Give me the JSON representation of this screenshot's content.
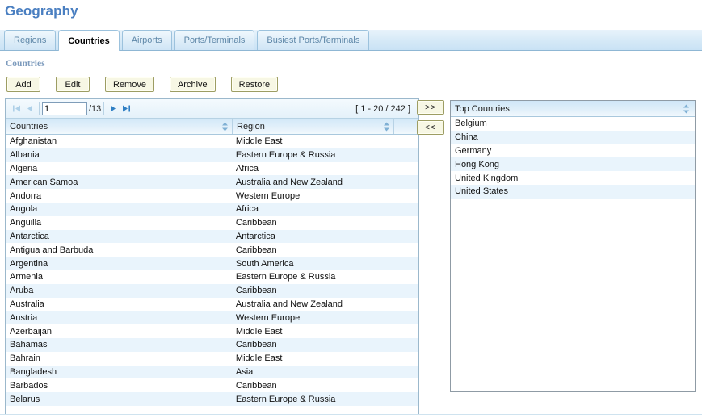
{
  "page": {
    "title": "Geography",
    "section_caption": "Countries",
    "title_color": "#4a7fc1",
    "caption_color": "#7d9bbd"
  },
  "tabs": [
    {
      "label": "Regions",
      "active": false
    },
    {
      "label": "Countries",
      "active": true
    },
    {
      "label": "Airports",
      "active": false
    },
    {
      "label": "Ports/Terminals",
      "active": false
    },
    {
      "label": "Busiest Ports/Terminals",
      "active": false
    }
  ],
  "toolbar": {
    "buttons": [
      {
        "label": "Add",
        "name": "add-button"
      },
      {
        "label": "Edit",
        "name": "edit-button"
      },
      {
        "label": "Remove",
        "name": "remove-button"
      },
      {
        "label": "Archive",
        "name": "archive-button"
      },
      {
        "label": "Restore",
        "name": "restore-button"
      }
    ]
  },
  "pager": {
    "page_value": "1",
    "page_total": "/13",
    "range_text": "[ 1 - 20 / 242 ]",
    "first_enabled": false,
    "prev_enabled": false,
    "next_enabled": true,
    "last_enabled": true
  },
  "grid": {
    "columns": [
      "Countries",
      "Region"
    ],
    "rows": [
      {
        "country": "Afghanistan",
        "region": "Middle East"
      },
      {
        "country": "Albania",
        "region": "Eastern Europe & Russia"
      },
      {
        "country": "Algeria",
        "region": "Africa"
      },
      {
        "country": "American Samoa",
        "region": "Australia and New Zealand"
      },
      {
        "country": "Andorra",
        "region": "Western Europe"
      },
      {
        "country": "Angola",
        "region": "Africa"
      },
      {
        "country": "Anguilla",
        "region": "Caribbean"
      },
      {
        "country": "Antarctica",
        "region": "Antarctica"
      },
      {
        "country": "Antigua and Barbuda",
        "region": "Caribbean"
      },
      {
        "country": "Argentina",
        "region": "South America"
      },
      {
        "country": "Armenia",
        "region": "Eastern Europe & Russia"
      },
      {
        "country": "Aruba",
        "region": "Caribbean"
      },
      {
        "country": "Australia",
        "region": "Australia and New Zealand"
      },
      {
        "country": "Austria",
        "region": "Western Europe"
      },
      {
        "country": "Azerbaijan",
        "region": "Middle East"
      },
      {
        "country": "Bahamas",
        "region": "Caribbean"
      },
      {
        "country": "Bahrain",
        "region": "Middle East"
      },
      {
        "country": "Bangladesh",
        "region": "Asia"
      },
      {
        "country": "Barbados",
        "region": "Caribbean"
      },
      {
        "country": "Belarus",
        "region": "Eastern Europe & Russia"
      }
    ]
  },
  "transfer": {
    "add_label": ">>",
    "remove_label": "<<"
  },
  "top_countries": {
    "header": "Top Countries",
    "items": [
      "Belgium",
      "China",
      "Germany",
      "Hong Kong",
      "United Kingdom",
      "United States"
    ]
  },
  "colors": {
    "row_stripe": "#e9f4fc",
    "header_blue": "#d2e8f8",
    "button_face": "#f7f7e4",
    "button_border": "#9d9d63",
    "arrow_active": "#2f7fc4",
    "arrow_disabled": "#aed0e8"
  }
}
